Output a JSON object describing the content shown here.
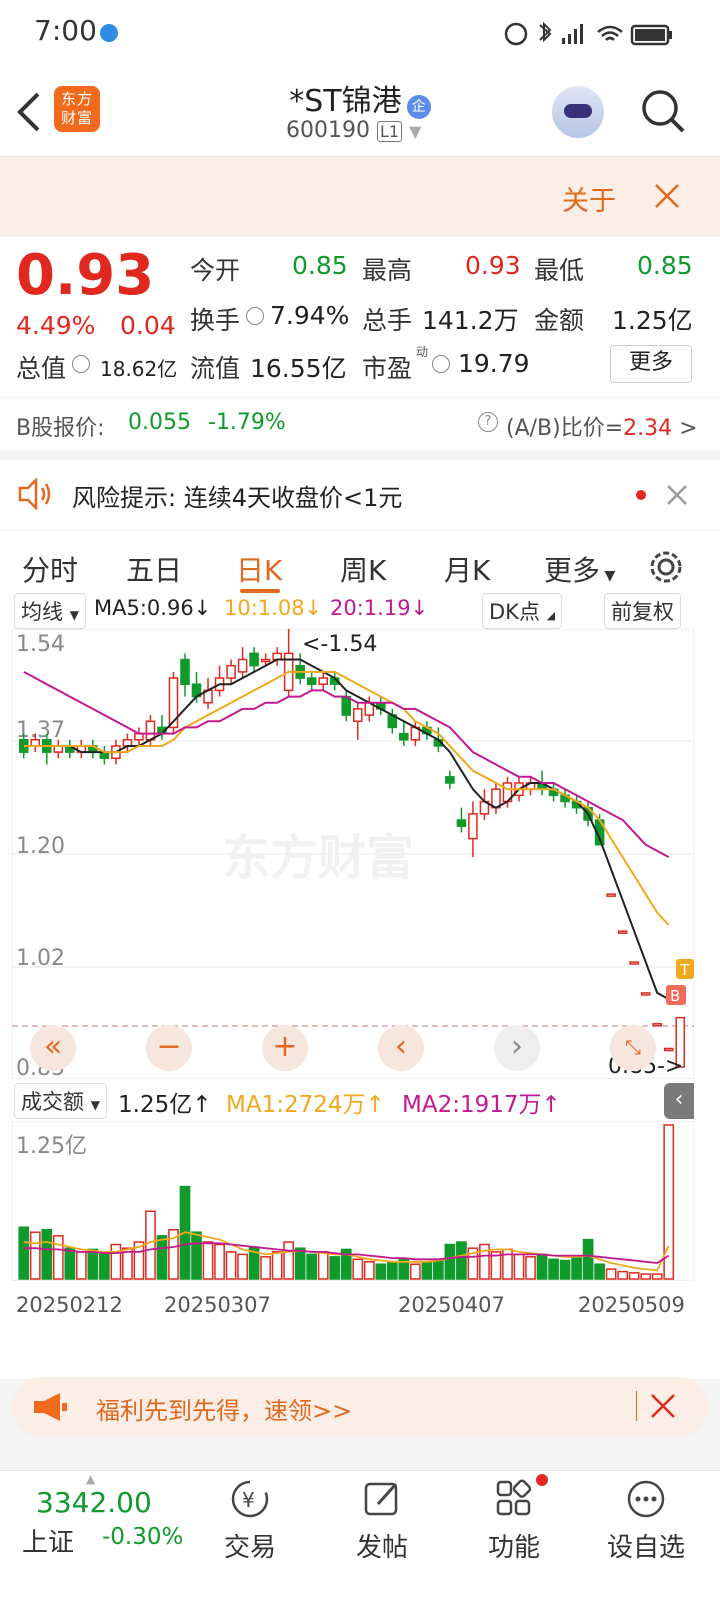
{
  "status": {
    "time": "7:00"
  },
  "header": {
    "logo_text": "东方财富",
    "title": "*ST锦港",
    "code": "600190",
    "level": "L1"
  },
  "notice": {
    "about": "关于"
  },
  "quote": {
    "price": "0.93",
    "change_pct": "4.49%",
    "change": "0.04",
    "open_label": "今开",
    "open": "0.85",
    "high_label": "最高",
    "high": "0.93",
    "low_label": "最低",
    "low": "0.85",
    "turnover_label": "换手",
    "turnover": "7.94%",
    "volume_label": "总手",
    "volume": "141.2万",
    "amount_label": "金额",
    "amount": "1.25亿",
    "mktcap_label": "总值",
    "mktcap": "18.62亿",
    "float_label": "流值",
    "float": "16.55亿",
    "pe_label": "市盈",
    "pe_sup": "动",
    "pe": "19.79",
    "more": "更多"
  },
  "bshare": {
    "label": "B股报价:",
    "price": "0.055",
    "change_pct": "-1.79%",
    "ratio_label": "(A/B)比价=",
    "ratio": "2.34"
  },
  "risk": {
    "text": "风险提示:  连续4天收盘价<1元"
  },
  "tabs": [
    "分时",
    "五日",
    "日K",
    "周K",
    "月K",
    "更多"
  ],
  "kline": {
    "ma_selector": "均线",
    "ma5": "MA5:0.96↓",
    "ma10": "10:1.08↓",
    "ma20": "20:1.19↓",
    "dk": "DK点",
    "adjust": "前复权",
    "y_labels": [
      "1.54",
      "1.37",
      "1.20",
      "1.02",
      "0.85"
    ],
    "max_marker": "<-1.54",
    "min_marker": "0.85->",
    "watermark": "东方财富",
    "badge_t": "T",
    "badge_b": "B"
  },
  "volume": {
    "selector": "成交额",
    "value": "1.25亿↑",
    "ma1": "MA1:2724万↑",
    "ma2": "MA2:1917万↑",
    "y_label": "1.25亿",
    "dates": [
      "20250212",
      "20250307",
      "20250407",
      "20250509"
    ]
  },
  "promo": {
    "text": "福利先到先得，速领>>"
  },
  "bottom": {
    "index_value": "3342.00",
    "index_name": "上证",
    "index_change": "-0.30%",
    "nav": [
      "交易",
      "发帖",
      "功能",
      "设自选"
    ]
  },
  "colors": {
    "up": "#e0281f",
    "down": "#109a2c",
    "ma5": "#222222",
    "ma10": "#f2a81d",
    "ma20": "#c3198f",
    "accent": "#f26b1d"
  },
  "chart_data": {
    "type": "candlestick",
    "candles": [
      {
        "o": 1.38,
        "c": 1.36,
        "h": 1.39,
        "l": 1.35
      },
      {
        "o": 1.37,
        "c": 1.38,
        "h": 1.39,
        "l": 1.36
      },
      {
        "o": 1.38,
        "c": 1.36,
        "h": 1.39,
        "l": 1.34
      },
      {
        "o": 1.36,
        "c": 1.37,
        "h": 1.38,
        "l": 1.35
      },
      {
        "o": 1.37,
        "c": 1.36,
        "h": 1.38,
        "l": 1.35
      },
      {
        "o": 1.36,
        "c": 1.37,
        "h": 1.38,
        "l": 1.35
      },
      {
        "o": 1.37,
        "c": 1.36,
        "h": 1.38,
        "l": 1.35
      },
      {
        "o": 1.36,
        "c": 1.35,
        "h": 1.37,
        "l": 1.34
      },
      {
        "o": 1.35,
        "c": 1.37,
        "h": 1.38,
        "l": 1.34
      },
      {
        "o": 1.37,
        "c": 1.38,
        "h": 1.39,
        "l": 1.36
      },
      {
        "o": 1.38,
        "c": 1.39,
        "h": 1.4,
        "l": 1.37
      },
      {
        "o": 1.38,
        "c": 1.41,
        "h": 1.42,
        "l": 1.37
      },
      {
        "o": 1.4,
        "c": 1.39,
        "h": 1.42,
        "l": 1.38
      },
      {
        "o": 1.4,
        "c": 1.48,
        "h": 1.49,
        "l": 1.39
      },
      {
        "o": 1.51,
        "c": 1.47,
        "h": 1.52,
        "l": 1.45
      },
      {
        "o": 1.47,
        "c": 1.45,
        "h": 1.49,
        "l": 1.44
      },
      {
        "o": 1.44,
        "c": 1.46,
        "h": 1.48,
        "l": 1.43
      },
      {
        "o": 1.46,
        "c": 1.48,
        "h": 1.5,
        "l": 1.45
      },
      {
        "o": 1.48,
        "c": 1.5,
        "h": 1.51,
        "l": 1.47
      },
      {
        "o": 1.49,
        "c": 1.51,
        "h": 1.53,
        "l": 1.48
      },
      {
        "o": 1.52,
        "c": 1.5,
        "h": 1.53,
        "l": 1.49
      },
      {
        "o": 1.51,
        "c": 1.51,
        "h": 1.52,
        "l": 1.5
      },
      {
        "o": 1.51,
        "c": 1.52,
        "h": 1.53,
        "l": 1.5
      },
      {
        "o": 1.46,
        "c": 1.52,
        "h": 1.56,
        "l": 1.45
      },
      {
        "o": 1.5,
        "c": 1.48,
        "h": 1.52,
        "l": 1.47
      },
      {
        "o": 1.48,
        "c": 1.47,
        "h": 1.49,
        "l": 1.46
      },
      {
        "o": 1.47,
        "c": 1.48,
        "h": 1.49,
        "l": 1.46
      },
      {
        "o": 1.48,
        "c": 1.47,
        "h": 1.49,
        "l": 1.46
      },
      {
        "o": 1.45,
        "c": 1.42,
        "h": 1.46,
        "l": 1.41
      },
      {
        "o": 1.41,
        "c": 1.43,
        "h": 1.44,
        "l": 1.38
      },
      {
        "o": 1.42,
        "c": 1.44,
        "h": 1.45,
        "l": 1.41
      },
      {
        "o": 1.44,
        "c": 1.43,
        "h": 1.45,
        "l": 1.42
      },
      {
        "o": 1.42,
        "c": 1.4,
        "h": 1.43,
        "l": 1.39
      },
      {
        "o": 1.39,
        "c": 1.38,
        "h": 1.41,
        "l": 1.37
      },
      {
        "o": 1.38,
        "c": 1.4,
        "h": 1.41,
        "l": 1.37
      },
      {
        "o": 1.4,
        "c": 1.39,
        "h": 1.41,
        "l": 1.38
      },
      {
        "o": 1.38,
        "c": 1.37,
        "h": 1.4,
        "l": 1.36
      },
      {
        "o": 1.32,
        "c": 1.31,
        "h": 1.33,
        "l": 1.3
      },
      {
        "o": 1.25,
        "c": 1.24,
        "h": 1.27,
        "l": 1.23
      },
      {
        "o": 1.22,
        "c": 1.26,
        "h": 1.28,
        "l": 1.19
      },
      {
        "o": 1.26,
        "c": 1.28,
        "h": 1.3,
        "l": 1.25
      },
      {
        "o": 1.27,
        "c": 1.3,
        "h": 1.31,
        "l": 1.26
      },
      {
        "o": 1.28,
        "c": 1.31,
        "h": 1.32,
        "l": 1.27
      },
      {
        "o": 1.29,
        "c": 1.31,
        "h": 1.32,
        "l": 1.28
      },
      {
        "o": 1.3,
        "c": 1.31,
        "h": 1.32,
        "l": 1.29
      },
      {
        "o": 1.31,
        "c": 1.3,
        "h": 1.33,
        "l": 1.29
      },
      {
        "o": 1.3,
        "c": 1.29,
        "h": 1.31,
        "l": 1.28
      },
      {
        "o": 1.29,
        "c": 1.28,
        "h": 1.3,
        "l": 1.27
      },
      {
        "o": 1.28,
        "c": 1.27,
        "h": 1.29,
        "l": 1.26
      },
      {
        "o": 1.27,
        "c": 1.25,
        "h": 1.28,
        "l": 1.24
      },
      {
        "o": 1.25,
        "c": 1.21,
        "h": 1.26,
        "l": 1.21
      },
      {
        "o": 1.13,
        "c": 1.13,
        "h": 1.13,
        "l": 1.13
      },
      {
        "o": 1.07,
        "c": 1.07,
        "h": 1.07,
        "l": 1.07
      },
      {
        "o": 1.02,
        "c": 1.02,
        "h": 1.02,
        "l": 1.02
      },
      {
        "o": 0.97,
        "c": 0.97,
        "h": 0.97,
        "l": 0.97
      },
      {
        "o": 0.92,
        "c": 0.92,
        "h": 0.92,
        "l": 0.92
      },
      {
        "o": 0.88,
        "c": 0.88,
        "h": 0.88,
        "l": 0.88
      },
      {
        "o": 0.85,
        "c": 0.93,
        "h": 0.93,
        "l": 0.85
      }
    ],
    "ma5": [
      1.37,
      1.37,
      1.37,
      1.37,
      1.37,
      1.36,
      1.36,
      1.36,
      1.36,
      1.37,
      1.37,
      1.38,
      1.39,
      1.41,
      1.43,
      1.45,
      1.46,
      1.47,
      1.47,
      1.48,
      1.49,
      1.5,
      1.51,
      1.51,
      1.51,
      1.5,
      1.49,
      1.48,
      1.46,
      1.45,
      1.44,
      1.43,
      1.42,
      1.41,
      1.4,
      1.39,
      1.38,
      1.36,
      1.33,
      1.3,
      1.28,
      1.27,
      1.28,
      1.3,
      1.31,
      1.31,
      1.3,
      1.29,
      1.28,
      1.26,
      1.22,
      1.17,
      1.12,
      1.07,
      1.02,
      0.97,
      0.96
    ],
    "ma10": [
      1.37,
      1.37,
      1.37,
      1.37,
      1.37,
      1.37,
      1.37,
      1.36,
      1.36,
      1.36,
      1.37,
      1.37,
      1.37,
      1.38,
      1.4,
      1.41,
      1.42,
      1.43,
      1.44,
      1.45,
      1.46,
      1.47,
      1.48,
      1.49,
      1.49,
      1.49,
      1.49,
      1.49,
      1.48,
      1.47,
      1.46,
      1.45,
      1.44,
      1.43,
      1.41,
      1.4,
      1.39,
      1.37,
      1.35,
      1.33,
      1.32,
      1.31,
      1.3,
      1.3,
      1.3,
      1.3,
      1.3,
      1.29,
      1.28,
      1.27,
      1.25,
      1.22,
      1.19,
      1.16,
      1.13,
      1.1,
      1.08
    ],
    "ma20": [
      1.49,
      1.48,
      1.47,
      1.46,
      1.45,
      1.44,
      1.43,
      1.42,
      1.41,
      1.4,
      1.39,
      1.39,
      1.39,
      1.39,
      1.4,
      1.4,
      1.41,
      1.41,
      1.42,
      1.43,
      1.43,
      1.44,
      1.44,
      1.45,
      1.45,
      1.46,
      1.46,
      1.45,
      1.45,
      1.44,
      1.44,
      1.44,
      1.44,
      1.43,
      1.43,
      1.42,
      1.41,
      1.4,
      1.38,
      1.36,
      1.35,
      1.34,
      1.33,
      1.32,
      1.32,
      1.31,
      1.31,
      1.3,
      1.29,
      1.28,
      1.27,
      1.26,
      1.25,
      1.23,
      1.21,
      1.2,
      1.19
    ],
    "volume": [
      42,
      38,
      40,
      35,
      25,
      22,
      24,
      20,
      28,
      25,
      30,
      55,
      35,
      40,
      75,
      38,
      30,
      28,
      22,
      20,
      26,
      18,
      22,
      30,
      25,
      20,
      22,
      18,
      24,
      16,
      14,
      12,
      14,
      16,
      12,
      14,
      15,
      28,
      30,
      25,
      28,
      22,
      24,
      20,
      18,
      20,
      16,
      15,
      18,
      32,
      12,
      8,
      6,
      5,
      4,
      4,
      125
    ],
    "volume_ma1": [
      30,
      29,
      30,
      28,
      26,
      24,
      23,
      22,
      22,
      24,
      26,
      30,
      32,
      33,
      38,
      36,
      34,
      32,
      28,
      24,
      22,
      20,
      21,
      22,
      23,
      22,
      21,
      20,
      20,
      18,
      16,
      15,
      14,
      14,
      14,
      14,
      15,
      17,
      19,
      21,
      23,
      24,
      24,
      22,
      21,
      20,
      19,
      18,
      18,
      19,
      16,
      13,
      11,
      9,
      8,
      7,
      27
    ],
    "volume_ma2": [
      25,
      25,
      24,
      24,
      23,
      22,
      22,
      21,
      21,
      22,
      22,
      24,
      25,
      26,
      28,
      29,
      29,
      29,
      28,
      27,
      26,
      25,
      24,
      23,
      23,
      22,
      22,
      21,
      20,
      20,
      19,
      18,
      17,
      17,
      16,
      16,
      16,
      17,
      18,
      18,
      19,
      19,
      20,
      20,
      20,
      20,
      19,
      19,
      19,
      19,
      18,
      17,
      16,
      15,
      14,
      13,
      19
    ],
    "ylim": [
      0.85,
      1.54
    ]
  }
}
